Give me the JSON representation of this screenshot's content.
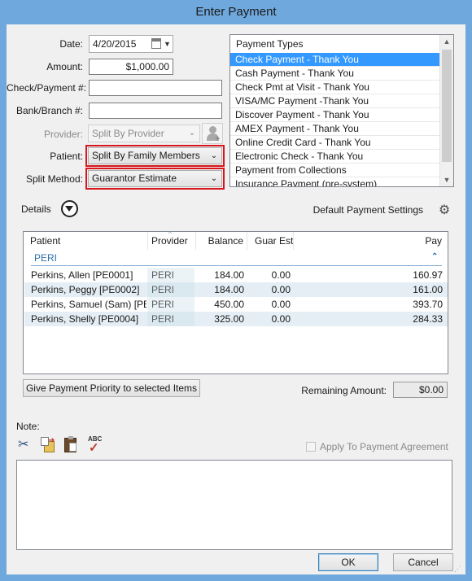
{
  "window": {
    "title": "Enter Payment"
  },
  "form": {
    "date_label": "Date:",
    "date_value": "4/20/2015",
    "amount_label": "Amount:",
    "amount_value": "$1,000.00",
    "check_label": "Check/Payment #:",
    "check_value": "",
    "bank_label": "Bank/Branch #:",
    "bank_value": "",
    "provider_label": "Provider:",
    "provider_value": "Split By Provider",
    "patient_label": "Patient:",
    "patient_value": "Split By Family Members",
    "split_label": "Split Method:",
    "split_value": "Guarantor Estimate"
  },
  "payment_types": {
    "header": "Payment Types",
    "items": [
      "Check Payment - Thank You",
      "Cash Payment - Thank You",
      "Check Pmt at Visit - Thank You",
      "VISA/MC Payment -Thank You",
      "Discover Payment - Thank You",
      "AMEX Payment - Thank You",
      "Online Credit Card - Thank You",
      "Electronic Check - Thank You",
      "Payment from Collections",
      "Insurance Payment (pre-system)"
    ],
    "selected_index": 0
  },
  "details": {
    "label": "Details",
    "default_settings_label": "Default Payment Settings"
  },
  "grid": {
    "columns": [
      "Patient",
      "Provider",
      "Balance",
      "Guar Est",
      "Pay"
    ],
    "group": "PERI",
    "rows": [
      {
        "patient": "Perkins, Allen [PE0001]",
        "provider": "PERI",
        "balance": "184.00",
        "guar_est": "0.00",
        "pay": "160.97"
      },
      {
        "patient": "Perkins, Peggy [PE0002]",
        "provider": "PERI",
        "balance": "184.00",
        "guar_est": "0.00",
        "pay": "161.00"
      },
      {
        "patient": "Perkins, Samuel (Sam) [PE0...",
        "provider": "PERI",
        "balance": "450.00",
        "guar_est": "0.00",
        "pay": "393.70"
      },
      {
        "patient": "Perkins, Shelly [PE0004]",
        "provider": "PERI",
        "balance": "325.00",
        "guar_est": "0.00",
        "pay": "284.33"
      }
    ]
  },
  "actions": {
    "priority_button": "Give Payment Priority to selected Items",
    "remaining_label": "Remaining Amount:",
    "remaining_value": "$0.00",
    "note_label": "Note:",
    "apply_agreement_label": "Apply To Payment Agreement",
    "note_text": "",
    "ok_label": "OK",
    "cancel_label": "Cancel"
  }
}
